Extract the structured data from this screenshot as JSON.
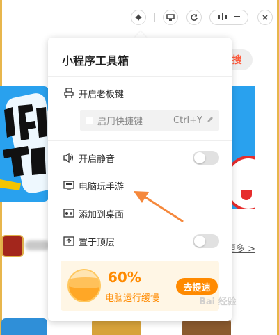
{
  "titlebar": {
    "icons": [
      "gamepad-icon",
      "monitor-icon",
      "refresh-icon",
      "more-icon",
      "minimize-icon",
      "close-icon"
    ]
  },
  "background": {
    "search_label": "搜",
    "more_link": "更多 >"
  },
  "popup": {
    "title": "小程序工具箱",
    "items": [
      {
        "label": "开启老板键",
        "icon": "boss-key-icon"
      },
      {
        "label": "开启静音",
        "icon": "speaker-icon",
        "toggle": false
      },
      {
        "label": "电脑玩手游",
        "icon": "monitor-game-icon"
      },
      {
        "label": "添加到桌面",
        "icon": "add-desktop-icon"
      },
      {
        "label": "置于顶层",
        "icon": "pin-top-icon",
        "toggle": false
      }
    ],
    "shortcut": {
      "checkbox_label": "启用快捷键",
      "checked": false,
      "key": "Ctrl+Y"
    },
    "performance": {
      "percent": "60%",
      "level": 0.6,
      "status": "电脑运行缓慢",
      "button": "去提速"
    }
  },
  "colors": {
    "accent": "#ff8a00",
    "banner_blue": "#29a1ee",
    "arrow": "#f5883c"
  },
  "watermark": "Bai 经验"
}
